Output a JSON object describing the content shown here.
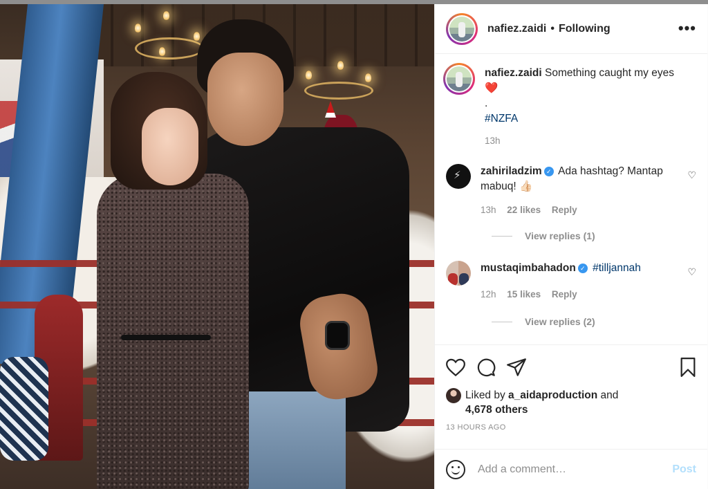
{
  "post": {
    "username": "nafiez.zaidi",
    "follow_state": "Following",
    "more_label": "•••",
    "separator": "•"
  },
  "caption": {
    "username": "nafiez.zaidi",
    "text": "Something caught my eyes ❤️",
    "line2": ".",
    "hashtag": "#NZFA",
    "time": "13h"
  },
  "comments": [
    {
      "username": "zahiriladzim",
      "verified": true,
      "text": "Ada hashtag? Mantap mabuq! 👍🏻",
      "time": "13h",
      "likes": "22 likes",
      "reply_label": "Reply",
      "view_replies": "View replies (1)"
    },
    {
      "username": "mustaqimbahadon",
      "verified": true,
      "text": "#tilljannah",
      "time": "12h",
      "likes": "15 likes",
      "reply_label": "Reply",
      "view_replies": "View replies (2)"
    }
  ],
  "likes": {
    "prefix": "Liked by",
    "user": "a_aidaproduction",
    "connector": "and",
    "others": "4,678 others"
  },
  "timestamp": "13 HOURS AGO",
  "add_comment": {
    "placeholder": "Add a comment…",
    "post_label": "Post"
  },
  "colors": {
    "link": "#00376b",
    "muted": "#8e8e8e",
    "post_disabled": "#b2dffc",
    "verified": "#3897f0"
  }
}
